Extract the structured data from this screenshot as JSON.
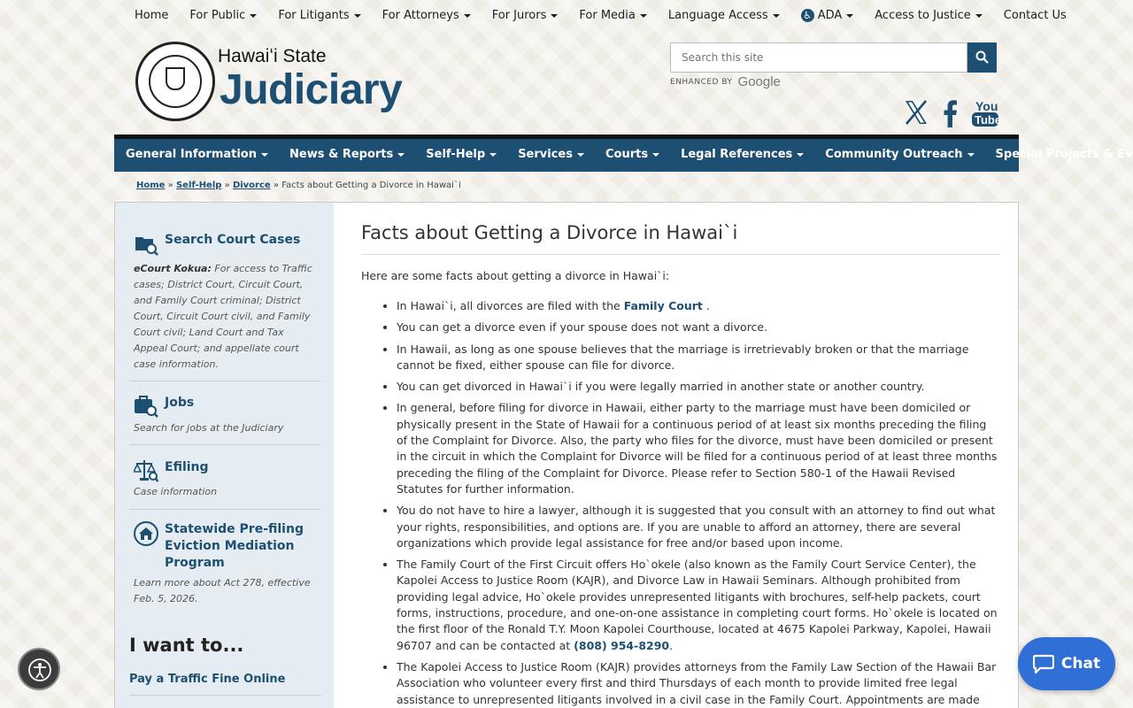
{
  "topnav": {
    "items": [
      {
        "label": "Home",
        "caret": false
      },
      {
        "label": "For Public",
        "caret": true
      },
      {
        "label": "For Litigants",
        "caret": true
      },
      {
        "label": "For Attorneys",
        "caret": true
      },
      {
        "label": "For Jurors",
        "caret": true
      },
      {
        "label": "For Media",
        "caret": true
      },
      {
        "label": "Language Access",
        "caret": true
      },
      {
        "label": "ADA",
        "caret": true
      },
      {
        "label": "Access to Justice",
        "caret": true
      },
      {
        "label": "Contact Us",
        "caret": false
      }
    ]
  },
  "header": {
    "logo_line1": "Hawaiʻi State",
    "logo_line2": "Judiciary",
    "search_placeholder": "Search this site",
    "enhanced_by": "ENHANCED BY",
    "google": "Google"
  },
  "mainnav": {
    "items": [
      "General Information",
      "News & Reports",
      "Self-Help",
      "Services",
      "Courts",
      "Legal References",
      "Community Outreach",
      "Special Projects & Events"
    ]
  },
  "breadcrumb": {
    "home": "Home",
    "sep": "»",
    "selfhelp": "Self-Help",
    "divorce": "Divorce",
    "current": "Facts about Getting a Divorce in Hawai`i"
  },
  "sidebar": {
    "search_title": "Search Court Cases",
    "search_desc_bold": "eCourt Kokua:",
    "search_desc": " For access to Traffic cases; District Court, Circuit Court, and Family Court criminal; District Court, Circuit Court civil, and Family Court civil; Land Court and Tax Appeal Court; and appellate court case information.",
    "jobs_title": "Jobs",
    "jobs_desc": "Search for jobs at the Judiciary",
    "efiling_title": "Efiling",
    "efiling_desc": "Case information",
    "eviction_title": "Statewide Pre-filing Eviction Mediation Program",
    "eviction_desc": "Learn more about Act 278, effective Feb. 5, 2026.",
    "iwant": "I want to...",
    "iwant_link": "Pay a Traffic Fine Online"
  },
  "article": {
    "title": "Facts about Getting a Divorce in Hawai`i",
    "intro": "Here are some facts about getting a divorce in Hawai`i:",
    "b1_pre": "In Hawai`i, all divorces are filed with the ",
    "b1_link": "Family Court",
    "b1_post": " .",
    "b2": "You can get a divorce even if your spouse does not want a divorce.",
    "b3": "In Hawaii, as long as one spouse believes that the marriage is irretrievably broken or that the marriage cannot be fixed, either spouse can file for divorce.",
    "b4": "You can get divorced in Hawai`i if you were legally married in another state or another country.",
    "b5": "In general, before filing for divorce in Hawaii, either party to the marriage must have been domiciled or physically present in the State of Hawaii for a continuous period of at least six months preceding the filing of the Complaint for Divorce. Also, the party who files for the divorce, must have been domiciled or present in the circuit in which the Complaint for Divorce will be filed for a continuous period of at least three months preceding the filing of the Complaint for Divorce. Please refer to Section 580-1 of the Hawaii Revised Statutes for further information.",
    "b6": "You do not have to hire a lawyer, although it is suggested that you consult with an attorney to find out what your rights, responsibilities, and options are. If you are unable to afford an attorney, there are several organizations which provide legal assistance for free and/or based upon income.",
    "b7_pre": "The Family Court of the First Circuit offers Ho`okele (also known as the Family Court Service Center), the Kapolei Access to Justice Room (KAJR), and Divorce Law in Hawaii Seminars. Although prohibited from providing legal advice, Ho`okele provides unrepresented litigants with brochures, self-help packets, court forms, instructions, procedure, and one-on-one assistance in completing court forms. Ho`okele is located on the first floor of the Ronald T.Y. Moon Kapolei Courthouse, located at 4675 Kapolei Parkway, Kapolei, Hawaii 96707 and can be contacted at ",
    "b7_link": "(808) 954-8290",
    "b7_post": ".",
    "b8": "The Kapolei Access to Justice Room (KAJR) provides attorneys from the Family Law Section of the Hawaii Bar Association who volunteer every first and third Thursdays of each month to provide limited free legal assistance to unrepresented litigants involved in a civil case in the Family Court. Appointments are made through Ho`okele"
  },
  "chat": {
    "label": "Chat"
  },
  "colors": {
    "brand": "#1d4f73",
    "chat": "#2f6fd6"
  }
}
